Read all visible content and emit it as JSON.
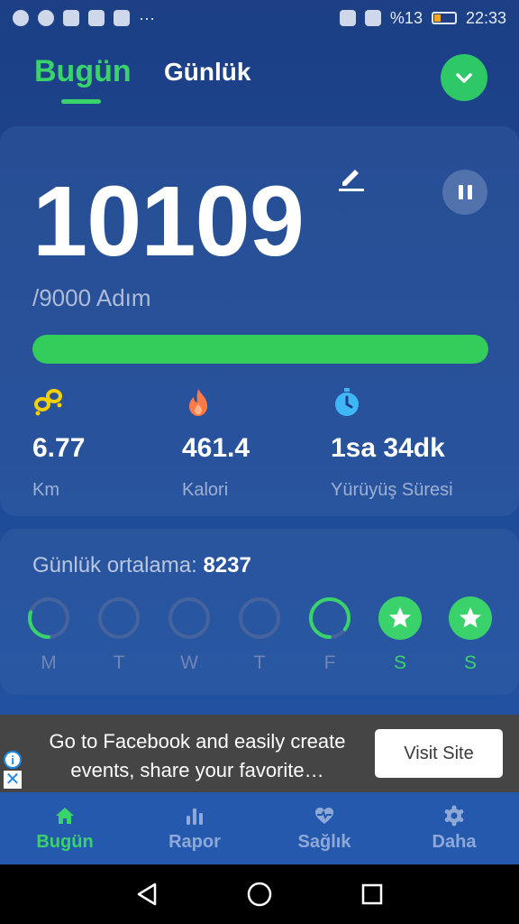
{
  "status_bar": {
    "battery": "%13",
    "time": "22:33",
    "dots": "···"
  },
  "header": {
    "tab_today": "Bugün",
    "tab_daily": "Günlük"
  },
  "steps": {
    "value": "10109",
    "goal": "/9000 Adım",
    "progress_percent": 100
  },
  "metrics": [
    {
      "value": "6.77",
      "label": "Km",
      "icon": "footprints-icon",
      "color": "#f5d000"
    },
    {
      "value": "461.4",
      "label": "Kalori",
      "icon": "flame-icon",
      "color": "#ff7a45"
    },
    {
      "value": "1sa 34dk",
      "label": "Yürüyüş Süresi",
      "icon": "stopwatch-icon",
      "color": "#3fb6f5"
    }
  ],
  "weekly": {
    "avg_label": "Günlük ortalama:",
    "avg_value": "8237",
    "days": [
      {
        "label": "M",
        "progress": 0.3,
        "done": false
      },
      {
        "label": "T",
        "progress": 0,
        "done": false
      },
      {
        "label": "W",
        "progress": 0,
        "done": false
      },
      {
        "label": "T",
        "progress": 0,
        "done": false
      },
      {
        "label": "F",
        "progress": 0.85,
        "done": false
      },
      {
        "label": "S",
        "progress": 1,
        "done": true
      },
      {
        "label": "S",
        "progress": 1,
        "done": true
      }
    ]
  },
  "ad": {
    "text": "Go to Facebook and easily create events, share your favorite…",
    "button": "Visit Site",
    "info": "i",
    "close": "✕"
  },
  "nav": [
    {
      "label": "Bugün",
      "icon": "home-icon",
      "active": true
    },
    {
      "label": "Rapor",
      "icon": "bar-chart-icon",
      "active": false
    },
    {
      "label": "Sağlık",
      "icon": "heart-pulse-icon",
      "active": false
    },
    {
      "label": "Daha",
      "icon": "gear-icon",
      "active": false
    }
  ],
  "colors": {
    "accent": "#3ad36b",
    "progress": "#32cd5a",
    "background": "#1f4d9a"
  }
}
